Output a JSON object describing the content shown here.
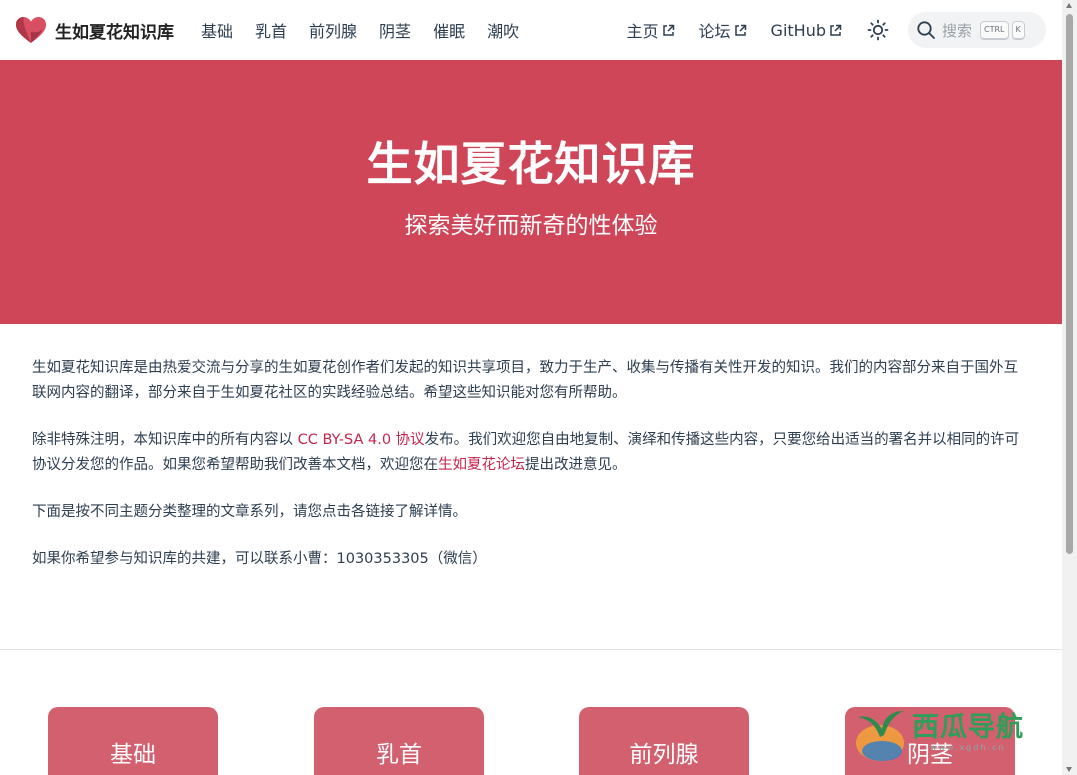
{
  "brand": {
    "name": "生如夏花知识库",
    "icon": "heart-logo-icon"
  },
  "nav": {
    "items": [
      {
        "label": "基础"
      },
      {
        "label": "乳首"
      },
      {
        "label": "前列腺"
      },
      {
        "label": "阴茎"
      },
      {
        "label": "催眠"
      },
      {
        "label": "潮吹"
      }
    ],
    "external": [
      {
        "label": "主页",
        "icon": "external-link-icon"
      },
      {
        "label": "论坛",
        "icon": "external-link-icon"
      },
      {
        "label": "GitHub",
        "icon": "external-link-icon"
      }
    ],
    "theme_icon": "sun-icon"
  },
  "search": {
    "placeholder": "搜索",
    "keys": [
      "CTRL",
      "K"
    ],
    "icon": "search-icon"
  },
  "hero": {
    "title": "生如夏花知识库",
    "subtitle": "探索美好而新奇的性体验",
    "color": "#cf4658"
  },
  "content": {
    "p1": "生如夏花知识库是由热爱交流与分享的生如夏花创作者们发起的知识共享项目，致力于生产、收集与传播有关性开发的知识。我们的内容部分来自于国外互联网内容的翻译，部分来自于生如夏花社区的实践经验总结。希望这些知识能对您有所帮助。",
    "p2_a": "除非特殊注明，本知识库中的所有内容以 ",
    "p2_link1": "CC BY-SA 4.0 协议",
    "p2_b": "发布。我们欢迎您自由地复制、演绎和传播这些内容，只要您给出适当的署名并以相同的许可协议分发您的作品。如果您希望帮助我们改善本文档，欢迎您在",
    "p2_link2": "生如夏花论坛",
    "p2_c": "提出改进意见。",
    "p3": "下面是按不同主题分类整理的文章系列，请您点击各链接了解详情。",
    "p4": "如果你希望参与知识库的共建，可以联系小曹：1030353305（微信）",
    "link_color": "#c7254e"
  },
  "cards": [
    {
      "label": "基础"
    },
    {
      "label": "乳首"
    },
    {
      "label": "前列腺"
    },
    {
      "label": "阴茎"
    }
  ],
  "watermark": {
    "text": "西瓜导航",
    "url": "www.xgdh.cn"
  }
}
